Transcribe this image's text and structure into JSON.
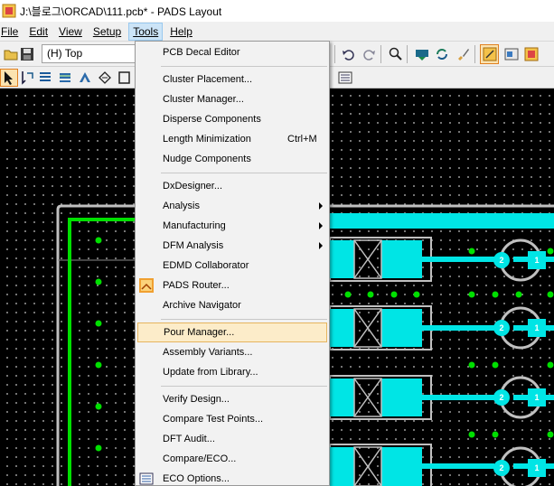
{
  "window": {
    "title": "J:\\블로그\\ORCAD\\111.pcb* - PADS Layout"
  },
  "menubar": [
    "File",
    "Edit",
    "View",
    "Setup",
    "Tools",
    "Help"
  ],
  "toolbar": {
    "layer_value": "(H) Top"
  },
  "tools_menu": {
    "items": [
      {
        "label": "PCB Decal Editor"
      },
      {
        "label": "Cluster Placement..."
      },
      {
        "label": "Cluster Manager..."
      },
      {
        "label": "Disperse Components"
      },
      {
        "label": "Length Minimization",
        "shortcut": "Ctrl+M"
      },
      {
        "label": "Nudge Components"
      },
      {
        "label": "DxDesigner..."
      },
      {
        "label": "Analysis"
      },
      {
        "label": "Manufacturing"
      },
      {
        "label": "DFM Analysis"
      },
      {
        "label": "EDMD Collaborator"
      },
      {
        "label": "PADS Router..."
      },
      {
        "label": "Archive Navigator"
      },
      {
        "label": "Pour Manager..."
      },
      {
        "label": "Assembly Variants..."
      },
      {
        "label": "Update from Library..."
      },
      {
        "label": "Verify Design..."
      },
      {
        "label": "Compare Test Points..."
      },
      {
        "label": "DFT Audit..."
      },
      {
        "label": "Compare/ECO..."
      },
      {
        "label": "ECO Options..."
      }
    ]
  },
  "pcb": {
    "pad_labels": [
      "2",
      "1",
      "2",
      "1",
      "2",
      "1",
      "2",
      "1"
    ]
  },
  "colors": {
    "trace": "#00e5e5",
    "board_outline": "#c0c0c0",
    "green": "#00e000"
  }
}
